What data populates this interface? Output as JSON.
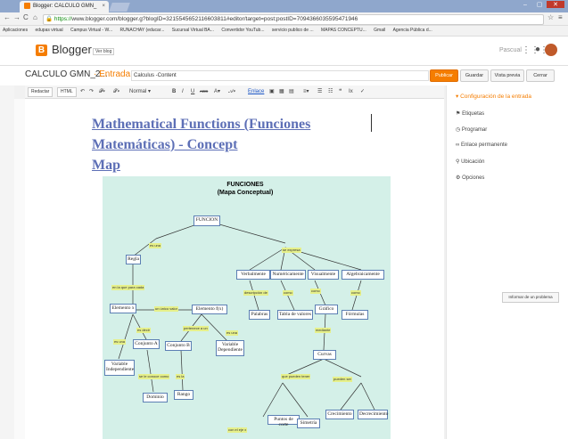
{
  "browser": {
    "tab_title": "Blogger: CALCULO GMN_",
    "tab_close": "×",
    "url_prefix": "https://",
    "url": "www.blogger.com/blogger.g?blogID=3215545652116603811#editor/target=post;postID=7094366035595471946",
    "window_controls": [
      "–",
      "▢",
      "✕"
    ],
    "bookmarks": [
      "Aplicaciones",
      "edupas virtual",
      "Campus Virtual - W...",
      "RUNACHAY (educar...",
      "Sucursal Virtual BA...",
      "Convertidor YouTub...",
      "servicio publico de ...",
      "MAPAS CONCEPTU...",
      "Gmail",
      "Agencia Pública d..."
    ]
  },
  "blogger": {
    "brand": "Blogger",
    "blog_button": "Ver blog",
    "user": "Pascual",
    "blog_title": "CALCULO GMN_2...",
    "breadcrumb_sep": "· Entrada",
    "post_title": "Calculus -Content",
    "buttons": {
      "publish": "Publicar",
      "save": "Guardar",
      "preview": "Vista previa",
      "close": "Cerrar"
    }
  },
  "toolbar": {
    "compose": "Redactar",
    "html": "HTML",
    "format": "Normal",
    "icons": [
      "↶",
      "↷",
      "𝓕▾",
      "𝓣▾",
      "B",
      "I",
      "U",
      "ABC",
      "A▾",
      "𝒜▾",
      "Enlace",
      "▣",
      "▦",
      "▤",
      "≡▾",
      "☰",
      "☷",
      "❝",
      "Ⅰx",
      "✓"
    ]
  },
  "post": {
    "heading_line1": "Mathematical Functions (Funciones Matemáticas) - Concept",
    "heading_line2": "Map"
  },
  "concept_map": {
    "title": "FUNCIONES",
    "subtitle": "(Mapa Conceptual)",
    "nodes": {
      "funcion": "FUNCION",
      "regla": "Regla",
      "elemento_x": "Elemento x",
      "elemento_fx": "Elemento f(x)",
      "conjunto_a": "Conjunto A",
      "conjunto_b": "Conjunto B",
      "variable_indep": "Variable Independiente",
      "variable_dep": "Variable Dependiente",
      "dominio": "Dominio",
      "rango": "Rango",
      "verbalmente": "Verbalmente",
      "numericamente": "Numéricamente",
      "visualmente": "Visualmente",
      "algebraicamente": "Algebraicamente",
      "palabras": "Palabras",
      "tabla": "Tabla de valores",
      "grafico": "Gráfico",
      "formulas": "Fórmulas",
      "curvas": "Curvas",
      "puntos_corte": "Puntos de corte",
      "simetria": "Simetría",
      "crecimiento": "Crecimiento",
      "decrecimiento": "Decrecimiento"
    },
    "links": {
      "es_una": "es una",
      "se_expresa": "se expresa",
      "que_asigna": "en la que para cada",
      "un_unico": "un único valor",
      "es_decir": "es decir",
      "pertenece": "pertenece a un",
      "es_una2": "es una",
      "es_una3": "es una",
      "se_le_conoce": "se le conoce como",
      "es_la": "es la",
      "descripcion": "descripción de",
      "como": "como",
      "como2": "como",
      "como3": "como",
      "mediante": "mediante",
      "que_pueden": "que pueden tener",
      "pueden_ser": "pueden ser",
      "con_eje": "con el eje x"
    }
  },
  "sidebar": {
    "config": "Configuración de la entrada",
    "items": [
      "Etiquetas",
      "Programar",
      "Enlace permanente",
      "Ubicación",
      "Opciones"
    ],
    "report": "Informar de un problema"
  }
}
